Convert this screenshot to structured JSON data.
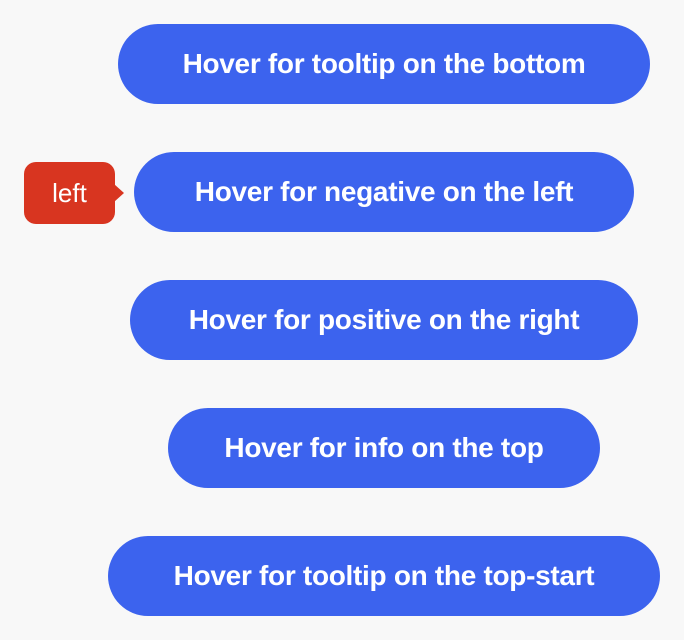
{
  "buttons": [
    {
      "label": "Hover for tooltip on the bottom"
    },
    {
      "label": "Hover for negative on the left"
    },
    {
      "label": "Hover for positive on the right"
    },
    {
      "label": "Hover for info on the top"
    },
    {
      "label": "Hover for tooltip on the top-start"
    }
  ],
  "tooltip": {
    "text": "left",
    "variant": "negative",
    "placement": "left"
  },
  "colors": {
    "background": "#f8f8f8",
    "button": "#3c63ee",
    "button_text": "#ffffff",
    "tooltip_negative": "#d83520"
  }
}
